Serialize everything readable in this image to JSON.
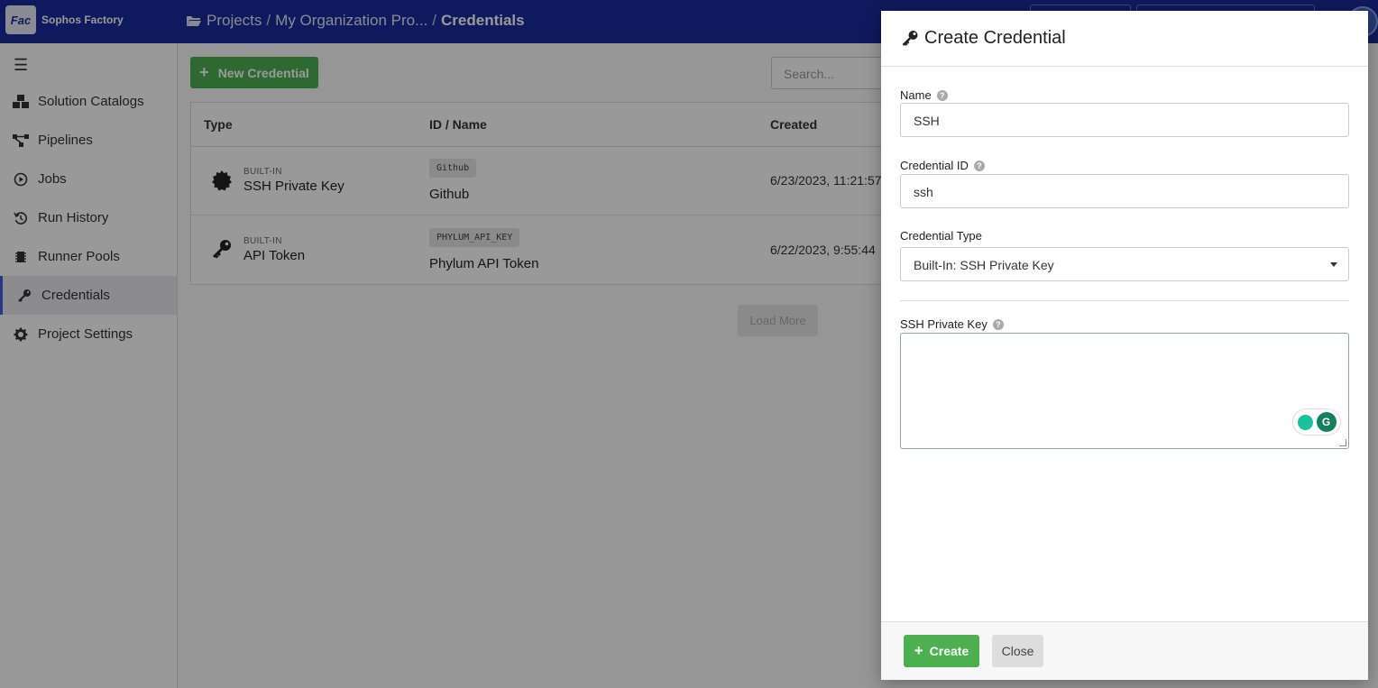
{
  "app": {
    "logo_mark": "Fac",
    "name": "Sophos Factory"
  },
  "breadcrumb": {
    "projects": "Projects",
    "sep1": "/",
    "organization": "My Organization Pro...",
    "sep2": "/",
    "current": "Credentials"
  },
  "sidebar": {
    "items": [
      {
        "label": "Solution Catalogs",
        "icon": "blocks-icon"
      },
      {
        "label": "Pipelines",
        "icon": "pipeline-icon"
      },
      {
        "label": "Jobs",
        "icon": "play-circle-icon"
      },
      {
        "label": "Run History",
        "icon": "history-icon"
      },
      {
        "label": "Runner Pools",
        "icon": "chip-icon"
      },
      {
        "label": "Credentials",
        "icon": "key-icon",
        "active": true
      },
      {
        "label": "Project Settings",
        "icon": "gear-icon"
      }
    ]
  },
  "toolbar": {
    "new_label": "New Credential",
    "search_placeholder": "Search..."
  },
  "table": {
    "headers": {
      "type": "Type",
      "id_name": "ID / Name",
      "created": "Created"
    },
    "rows": [
      {
        "type_tag": "BUILT-IN",
        "type": "SSH Private Key",
        "id": "Github",
        "name": "Github",
        "created": "6/23/2023, 11:21:57"
      },
      {
        "type_tag": "BUILT-IN",
        "type": "API Token",
        "id": "PHYLUM_API_KEY",
        "name": "Phylum API Token",
        "created": "6/22/2023, 9:55:44"
      }
    ],
    "load_more": "Load More"
  },
  "modal": {
    "title": "Create Credential",
    "name_label": "Name",
    "name_value": "SSH",
    "id_label": "Credential ID",
    "id_value": "ssh",
    "type_label": "Credential Type",
    "type_value": "Built-In: SSH Private Key",
    "key_label": "SSH Private Key",
    "key_value": "",
    "create_label": "Create",
    "close_label": "Close"
  },
  "colors": {
    "topbar": "#1a2b9b",
    "primary_green": "#4caf50",
    "active_accent": "#3d5fd9"
  }
}
